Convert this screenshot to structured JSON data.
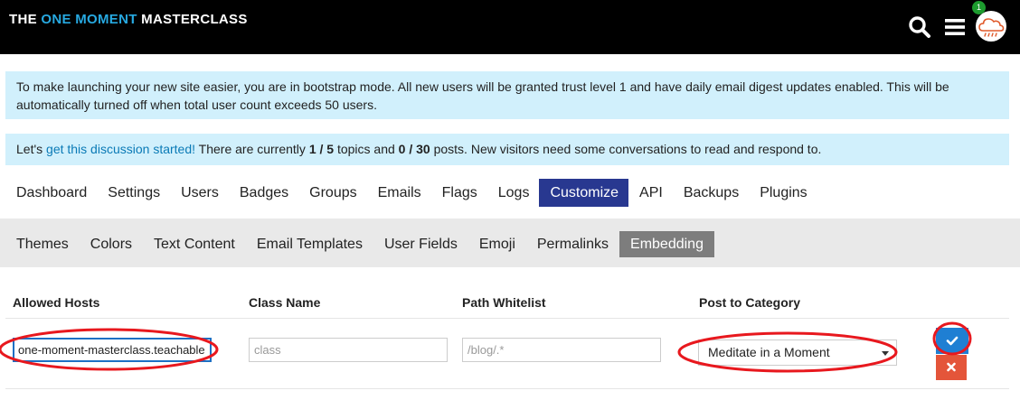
{
  "header": {
    "brand_pre": "THE ",
    "brand_highlight": "ONE MOMENT",
    "brand_post": " MASTERCLASS",
    "notification_count": "1",
    "icons": [
      "search-icon",
      "menu-icon",
      "avatar-cloud-icon"
    ]
  },
  "notices": {
    "bootstrap": "To make launching your new site easier, you are in bootstrap mode. All new users will be granted trust level 1 and have daily email digest updates enabled. This will be automatically turned off when total user count exceeds 50 users.",
    "discussion_pre": "Let's ",
    "discussion_link": "get this discussion started!",
    "discussion_mid1": " There are currently ",
    "topics": "1 / 5",
    "discussion_mid2": " topics and ",
    "posts": "0 / 30",
    "discussion_post": " posts. New visitors need some conversations to read and respond to."
  },
  "nav": {
    "items": [
      "Dashboard",
      "Settings",
      "Users",
      "Badges",
      "Groups",
      "Emails",
      "Flags",
      "Logs",
      "Customize",
      "API",
      "Backups",
      "Plugins"
    ],
    "active": "Customize"
  },
  "subnav": {
    "items": [
      "Themes",
      "Colors",
      "Text Content",
      "Email Templates",
      "User Fields",
      "Emoji",
      "Permalinks",
      "Embedding"
    ],
    "active": "Embedding"
  },
  "embedding": {
    "headers": {
      "allowed_hosts": "Allowed Hosts",
      "class_name": "Class Name",
      "path_whitelist": "Path Whitelist",
      "post_to_category": "Post to Category"
    },
    "row": {
      "allowed_hosts_value": "one-moment-masterclass.teachable",
      "class_name_placeholder": "class",
      "path_whitelist_placeholder": "/blog/.*",
      "category_value": "Meditate in a Moment"
    }
  },
  "colors": {
    "brand_highlight": "#27a9e1",
    "notice_bg": "#d1f0fc",
    "nav_active": "#283890",
    "subnav_active": "#7d7d7d",
    "save_button": "#1f7fd3",
    "cancel_button": "#e4553a",
    "annotation": "#e8181e"
  }
}
